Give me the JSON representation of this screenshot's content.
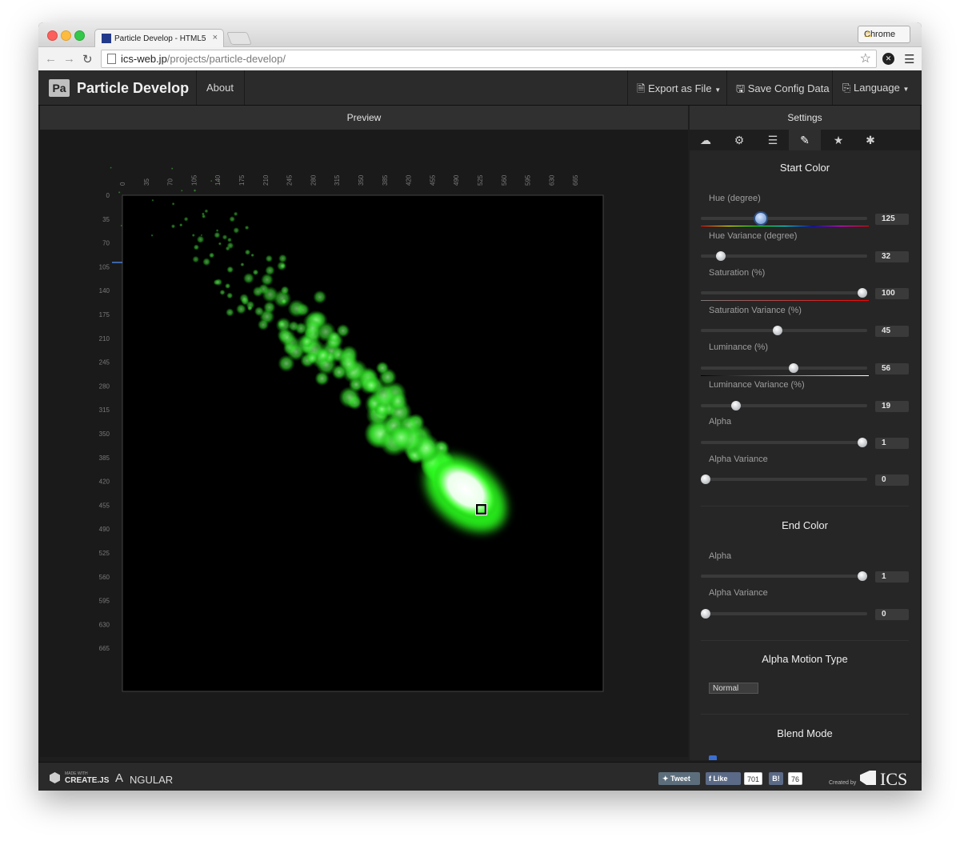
{
  "browser": {
    "tab_title": "Particle Develop - HTML5",
    "tab_close": "×",
    "profile_button": "Chrome",
    "url_host": "ics-web.jp",
    "url_path": "/projects/particle-develop/"
  },
  "nav": {
    "logo": "Pa",
    "brand": "Particle Develop",
    "about": "About",
    "export": "Export as File",
    "save": "Save Config Data",
    "language": "Language"
  },
  "preview": {
    "title": "Preview",
    "x_ticks": [
      "0",
      "35",
      "70",
      "105",
      "140",
      "175",
      "210",
      "245",
      "280",
      "315",
      "350",
      "385",
      "420",
      "455",
      "490",
      "525",
      "560",
      "595",
      "630",
      "665"
    ],
    "y_ticks": [
      "0",
      "35",
      "70",
      "105",
      "140",
      "175",
      "210",
      "245",
      "280",
      "315",
      "350",
      "385",
      "420",
      "455",
      "490",
      "525",
      "560",
      "595",
      "630",
      "665"
    ]
  },
  "settings": {
    "title": "Settings",
    "tabs": [
      "cloud-icon",
      "gears-icon",
      "sliders-icon",
      "brush-icon",
      "star-icon",
      "gear-icon"
    ],
    "start_color": {
      "title": "Start Color",
      "sliders": [
        {
          "label": "Hue (degree)",
          "value": "125",
          "fraction": 0.36
        },
        {
          "label": "Hue Variance (degree)",
          "value": "32",
          "fraction": 0.12
        },
        {
          "label": "Saturation (%)",
          "value": "100",
          "fraction": 0.97
        },
        {
          "label": "Saturation Variance (%)",
          "value": "45",
          "fraction": 0.46
        },
        {
          "label": "Luminance (%)",
          "value": "56",
          "fraction": 0.56
        },
        {
          "label": "Luminance Variance (%)",
          "value": "19",
          "fraction": 0.21
        },
        {
          "label": "Alpha",
          "value": "1",
          "fraction": 0.97
        },
        {
          "label": "Alpha Variance",
          "value": "0",
          "fraction": 0.03
        }
      ]
    },
    "end_color": {
      "title": "End Color",
      "sliders": [
        {
          "label": "Alpha",
          "value": "1",
          "fraction": 0.97
        },
        {
          "label": "Alpha Variance",
          "value": "0",
          "fraction": 0.03
        }
      ]
    },
    "alpha_motion": {
      "title": "Alpha Motion Type",
      "value": "Normal"
    },
    "blend_mode": {
      "title": "Blend Mode"
    }
  },
  "footer": {
    "createjs_small": "MADE WITH",
    "createjs": "CREATE.JS",
    "angular": "NGULAR",
    "tweet": "Tweet",
    "like": "Like",
    "like_count": "701",
    "hatena": "B!",
    "hatena_count": "76",
    "created_by": "Created by",
    "ics": "ICS"
  }
}
